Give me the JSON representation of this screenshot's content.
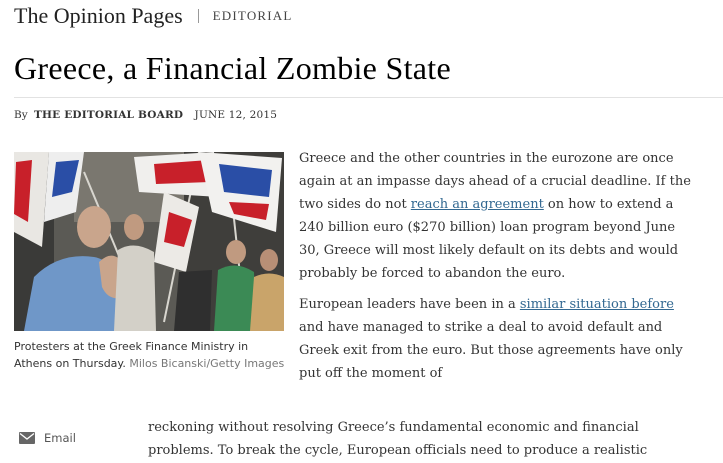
{
  "header": {
    "section_title": "The Opinion Pages",
    "section_sub": "EDITORIAL"
  },
  "article": {
    "headline": "Greece, a Financial Zombie State",
    "by_prefix": "By",
    "author": "THE EDITORIAL BOARD",
    "date": "JUNE 12, 2015",
    "para1_part1": "Greece and the other countries in the eurozone are once again at an impasse days ahead of a crucial deadline. If the two sides do not ",
    "para1_link": "reach an agreement",
    "para1_part2": " on how to extend a 240 billion euro ($270 billion) loan program beyond June 30, Greece will most likely default on its debts and would probably be forced to abandon the euro.",
    "para2_part1": "European leaders have been in a ",
    "para2_link": "similar situation before",
    "para2_part2": " and have managed to strike a deal to avoid default and Greek exit from the euro. But those agreements have only put off the moment of",
    "tail_text": "reckoning without resolving Greece’s fundamental economic and financial problems. To break the cycle, European officials need to produce a realistic"
  },
  "photo": {
    "caption": "Protesters at the Greek Finance Ministry in Athens on Thursday.",
    "credit": "Milos Bicanski/Getty Images"
  },
  "share": {
    "email_label": "Email",
    "icon": "envelope-icon"
  },
  "colors": {
    "link": "#326891",
    "text": "#333333",
    "headline": "#000000",
    "flag_red": "#c8202a",
    "flag_blue": "#2a4ea6"
  }
}
